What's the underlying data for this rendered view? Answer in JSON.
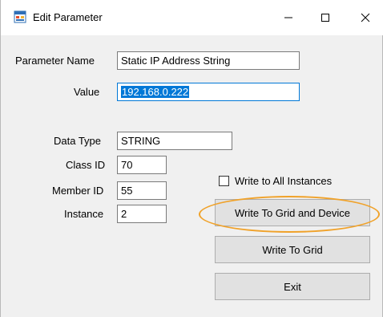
{
  "window": {
    "title": "Edit Parameter",
    "controls": {
      "minimize": "—",
      "maximize": "☐",
      "close": "✕"
    }
  },
  "form": {
    "parameter_name": {
      "label": "Parameter Name",
      "value": "Static IP Address String"
    },
    "value": {
      "label": "Value",
      "value": "192.168.0.222"
    },
    "data_type": {
      "label": "Data Type",
      "value": "STRING"
    },
    "class_id": {
      "label": "Class ID",
      "value": "70"
    },
    "member_id": {
      "label": "Member ID",
      "value": "55"
    },
    "instance": {
      "label": "Instance",
      "value": "2"
    }
  },
  "options": {
    "write_all_instances": {
      "label": "Write to All Instances",
      "checked": false
    }
  },
  "buttons": {
    "write_grid_device": "Write To Grid and Device",
    "write_grid": "Write To Grid",
    "exit": "Exit"
  },
  "colors": {
    "selection": "#0078d7",
    "highlight_ring": "#f0a22a"
  }
}
